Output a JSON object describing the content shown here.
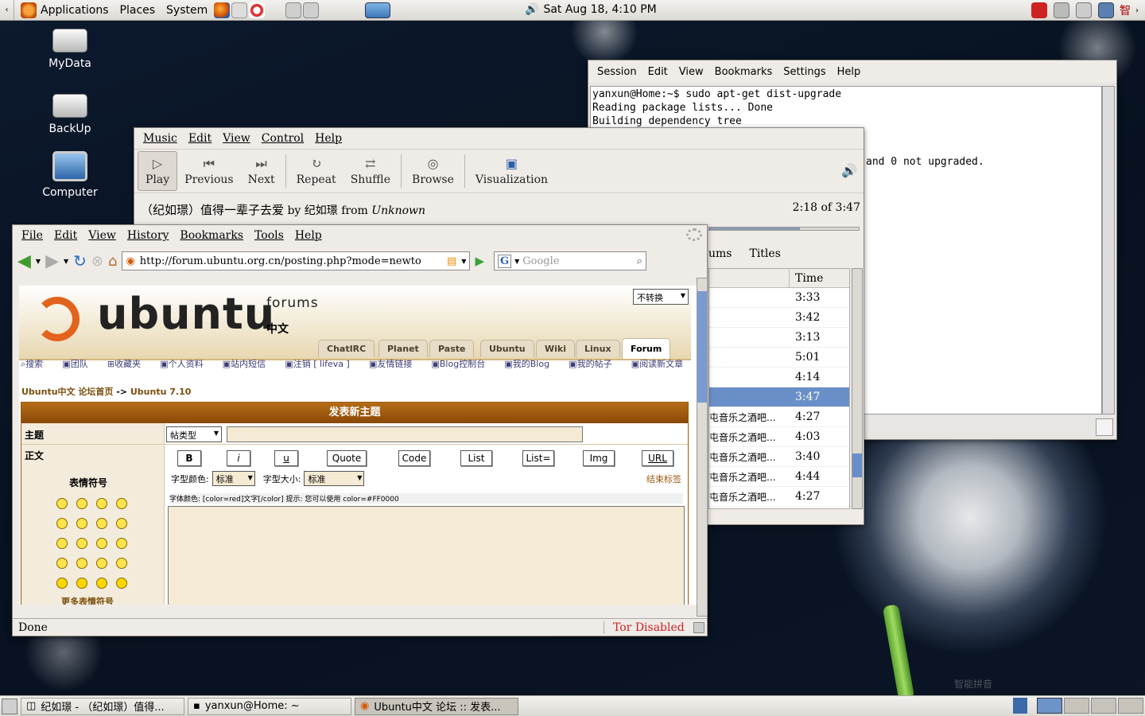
{
  "top_panel": {
    "applications": "Applications",
    "places": "Places",
    "system": "System",
    "clock": "Sat Aug 18,  4:10 PM",
    "ime": "智"
  },
  "desktop": {
    "icons": [
      "MyData",
      "BackUp",
      "Computer"
    ]
  },
  "terminal": {
    "menu": [
      "Session",
      "Edit",
      "View",
      "Bookmarks",
      "Settings",
      "Help"
    ],
    "lines": [
      "yanxun@Home:~$ sudo apt-get dist-upgrade",
      "Reading package lists... Done",
      "Building dependency tree"
    ],
    "tail": "and 0 not upgraded."
  },
  "rhythmbox": {
    "menu": [
      "Music",
      "Edit",
      "View",
      "Control",
      "Help"
    ],
    "buttons": {
      "play": "Play",
      "previous": "Previous",
      "next": "Next",
      "repeat": "Repeat",
      "shuffle": "Shuffle",
      "browse": "Browse",
      "visualization": "Visualization"
    },
    "track": "（纪如璟）值得一辈子去爱",
    "by": "by",
    "artist": "纪如璟",
    "from": "from",
    "album": "Unknown",
    "time": "2:18 of 3:47",
    "browser_headers": [
      "ums",
      "Titles"
    ],
    "time_header": "Time",
    "rows": [
      {
        "title": "",
        "time": "3:33"
      },
      {
        "title": "",
        "time": "3:42"
      },
      {
        "title": "",
        "time": "3:13"
      },
      {
        "title": "",
        "time": "5:01"
      },
      {
        "title": "",
        "time": "4:14"
      },
      {
        "title": "",
        "time": "3:47"
      },
      {
        "title": "屯音乐之酒吧...",
        "time": "4:27"
      },
      {
        "title": "屯音乐之酒吧...",
        "time": "4:03"
      },
      {
        "title": "屯音乐之酒吧...",
        "time": "3:40"
      },
      {
        "title": "屯音乐之酒吧...",
        "time": "4:44"
      },
      {
        "title": "屯音乐之酒吧...",
        "time": "4:27"
      }
    ],
    "selected_row": 5
  },
  "firefox": {
    "menu": [
      "File",
      "Edit",
      "View",
      "History",
      "Bookmarks",
      "Tools",
      "Help"
    ],
    "url": "http://forum.ubuntu.org.cn/posting.php?mode=newto",
    "search_placeholder": "Google",
    "status": "Done",
    "tor": "Tor Disabled"
  },
  "forum": {
    "logo_text": "ubuntu",
    "forums": "forums",
    "cn": "中文",
    "convert": "不转换",
    "tabs": [
      "ChatIRC",
      "Planet",
      "Paste",
      "Ubuntu",
      "Wiki",
      "Linux",
      "Forum"
    ],
    "links": [
      "搜索",
      "团队",
      "收藏夹",
      "个人资料",
      "站内短信",
      "注销 [ lifeva ]",
      "友情链接",
      "Blog控制台",
      "我的Blog",
      "我的帖子",
      "阅读新文章"
    ],
    "breadcrumb_home": "Ubuntu中文 论坛首页",
    "breadcrumb_arrow": "->",
    "breadcrumb_sub": "Ubuntu 7.10",
    "form_title": "发表新主题",
    "subject_label": "主题",
    "type_select": "帖类型",
    "body_label": "正文",
    "bbcode": [
      "B",
      "i",
      "u",
      "Quote",
      "Code",
      "List",
      "List=",
      "Img",
      "URL"
    ],
    "font_color_label": "字型颜色:",
    "font_color_value": "标准",
    "font_size_label": "字型大小:",
    "font_size_value": "标准",
    "close_tags": "结束标签",
    "hint": "字体颜色: [color=red]文字[/color]  提示: 您可以使用 color=#FF0000",
    "emoticons_title": "表情符号",
    "more_emoticons": "更多表情符号"
  },
  "taskbar": {
    "items": [
      "纪如璟 - （纪如璟）值得...",
      "yanxun@Home: ~",
      "Ubuntu中文 论坛 :: 发表..."
    ],
    "ime_text": "智能拼音"
  }
}
